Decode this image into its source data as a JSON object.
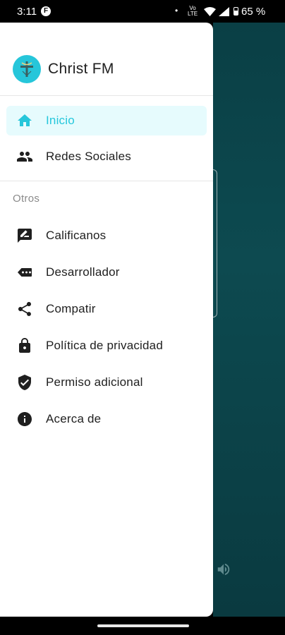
{
  "status_bar": {
    "time": "3:11",
    "notification_icon": "F",
    "network_label": "Vo LTE",
    "battery": "65 %"
  },
  "drawer": {
    "app_name": "Christ FM",
    "accent_color": "#26c6da",
    "primary_items": [
      {
        "label": "Inicio",
        "icon": "home-icon",
        "active": true
      },
      {
        "label": "Redes Sociales",
        "icon": "people-icon",
        "active": false
      }
    ],
    "section_title": "Otros",
    "other_items": [
      {
        "label": "Calificanos",
        "icon": "rate-review-icon"
      },
      {
        "label": "Desarrollador",
        "icon": "developer-tag-icon"
      },
      {
        "label": "Compatir",
        "icon": "share-icon"
      },
      {
        "label": "Política de privacidad",
        "icon": "lock-icon"
      },
      {
        "label": "Permiso adicional",
        "icon": "verified-shield-icon"
      },
      {
        "label": "Acerca de",
        "icon": "info-icon"
      }
    ]
  },
  "background": {
    "color": "#0b4248",
    "speaker_icon": "volume-icon"
  }
}
